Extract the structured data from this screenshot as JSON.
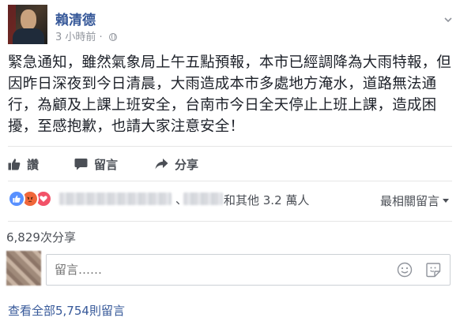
{
  "post": {
    "author": "賴清德",
    "time": "3 小時前",
    "separator": "·",
    "text": "緊急通知，雖然氣象局上午五點預報，本市已經調降為大雨特報，但因昨日深夜到今日清晨，大雨造成本市多處地方淹水，道路無法通行，為顧及上課上班安全，台南市今日全天停止上班上課，造成困擾，至感抱歉，也請大家注意安全！"
  },
  "actions": {
    "like_label": "讚",
    "comment_label": "留言",
    "share_label": "分享"
  },
  "reactions": {
    "icons": [
      "like-icon",
      "angry-icon",
      "love-icon"
    ],
    "separator": "、",
    "others_text": "和其他 3.2 萬人",
    "sort_label": "最相關留言"
  },
  "shares_text": "6,829次分享",
  "comment_box": {
    "placeholder": "留言……"
  },
  "view_all_comments": "查看全部5,754則留言",
  "colors": {
    "link_blue": "#365899",
    "secondary_text": "#90949c",
    "action_text": "#4b4f56",
    "like_blue": "#5890ff",
    "angry_orange": "#f0673a",
    "love_red": "#f25268"
  }
}
